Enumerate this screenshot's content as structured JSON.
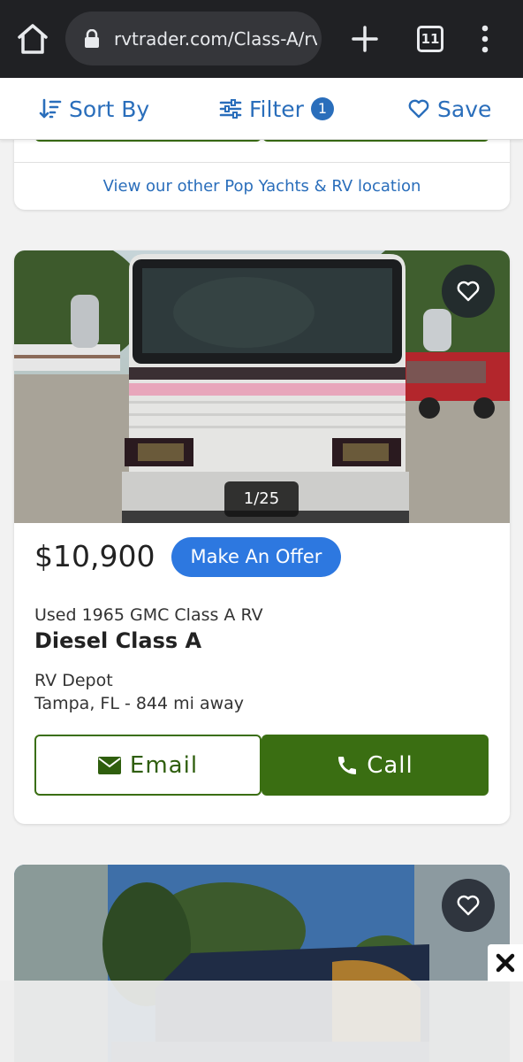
{
  "browser": {
    "url": "rvtrader.com/Class-A/rvs-for-sale",
    "tab_count": "11",
    "icons": [
      "home-icon",
      "lock-icon",
      "plus-icon",
      "tab-switcher-icon",
      "more-vert-icon"
    ]
  },
  "toolbar": {
    "sort_label": "Sort By",
    "filter_label": "Filter",
    "filter_count": "1",
    "save_label": "Save"
  },
  "previous_listing": {
    "location_link": "View our other Pop Yachts & RV location"
  },
  "listing": {
    "photo_counter": "1/25",
    "price": "$10,900",
    "offer_label": "Make An Offer",
    "subtitle": "Used 1965 GMC Class A RV",
    "title": "Diesel Class A",
    "dealer": "RV Depot",
    "location": "Tampa, FL - 844 mi away",
    "email_label": "Email",
    "call_label": "Call"
  },
  "colors": {
    "accent_blue": "#2a6ebb",
    "offer_blue": "#2d78e0",
    "action_green": "#3a6e12",
    "chrome_dark": "#202124"
  }
}
